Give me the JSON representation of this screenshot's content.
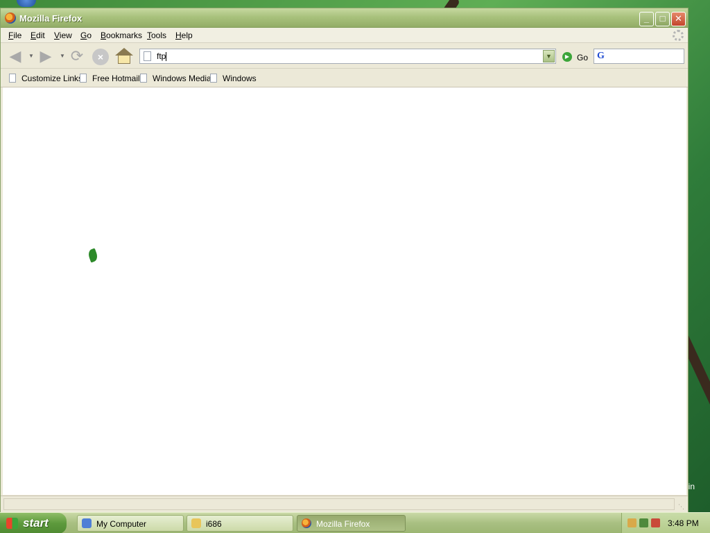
{
  "window": {
    "title": "Mozilla Firefox"
  },
  "titlebar_buttons": {
    "minimize": "_",
    "maximize": "□",
    "close": "✕"
  },
  "menu": {
    "items": [
      {
        "key": "F",
        "rest": "ile"
      },
      {
        "key": "E",
        "rest": "dit"
      },
      {
        "key": "V",
        "rest": "iew"
      },
      {
        "key": "G",
        "rest": "o"
      },
      {
        "key": "B",
        "rest": "ookmarks"
      },
      {
        "key": "T",
        "rest": "ools"
      },
      {
        "key": "H",
        "rest": "elp"
      }
    ]
  },
  "navbar": {
    "url_value": "ftp",
    "go_label": "Go",
    "search_engine_glyph": "G",
    "search_value": ""
  },
  "bookmarks": [
    "Customize Links",
    "Free Hotmail",
    "Windows Media",
    "Windows"
  ],
  "statusbar": {
    "text": ""
  },
  "desktop": {
    "partial_text": "in"
  },
  "taskbar": {
    "start_label": "start",
    "tasks": [
      {
        "label": "My Computer",
        "active": false
      },
      {
        "label": "i686",
        "active": false
      },
      {
        "label": "Mozilla Firefox",
        "active": true
      }
    ],
    "clock": "3:48 PM"
  },
  "icons": {
    "back": "back-arrow-icon",
    "forward": "forward-arrow-icon",
    "reload": "reload-icon",
    "stop": "stop-icon",
    "home": "home-icon",
    "go": "go-arrow-icon"
  },
  "colors": {
    "window_chrome": "#ece9d8",
    "titlebar": "#a9c27d",
    "taskbar": "#a9c082",
    "start_button": "#5d9a3c"
  }
}
